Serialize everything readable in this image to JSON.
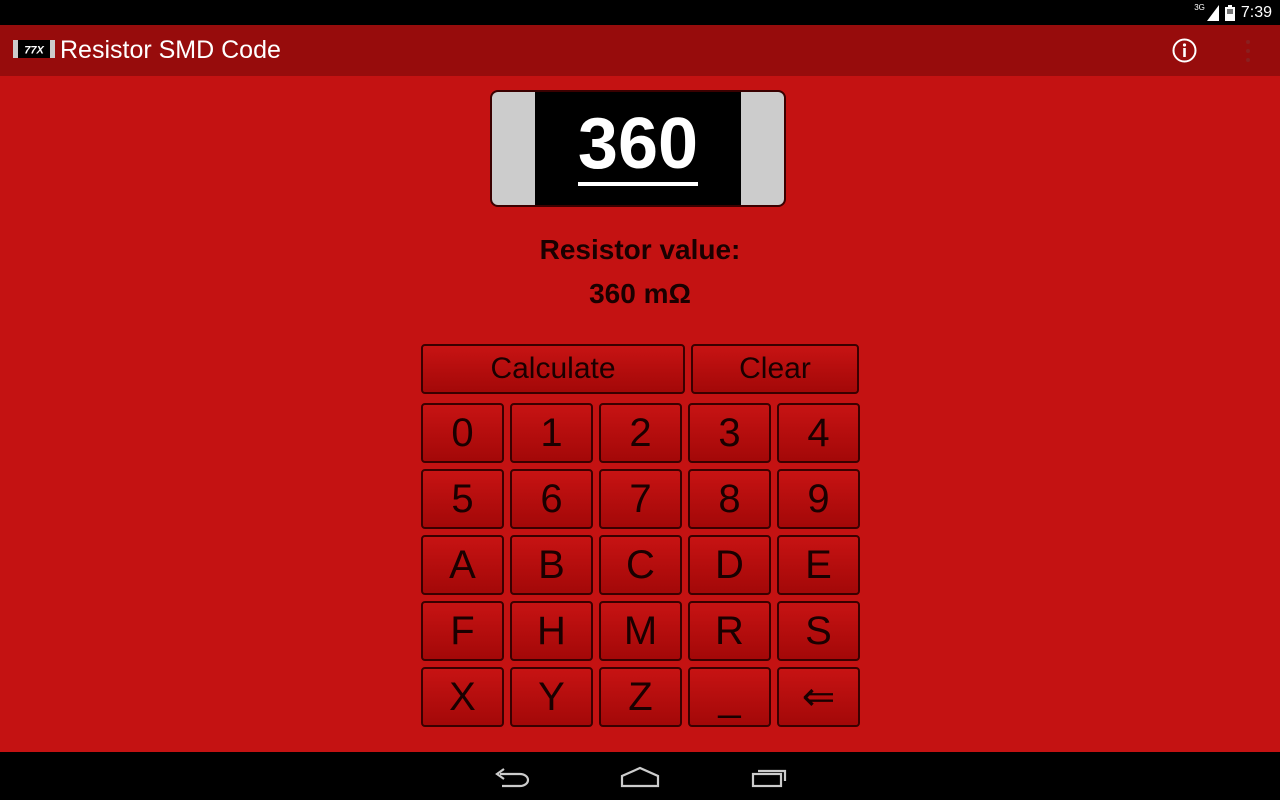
{
  "status": {
    "network": "3G",
    "time": "7:39"
  },
  "app": {
    "title": "Resistor SMD Code",
    "icon_text": "77X"
  },
  "chip": {
    "code": "360"
  },
  "result": {
    "label": "Resistor value:",
    "value": "360 mΩ"
  },
  "buttons": {
    "calculate": "Calculate",
    "clear": "Clear"
  },
  "keypad": [
    [
      "0",
      "1",
      "2",
      "3",
      "4"
    ],
    [
      "5",
      "6",
      "7",
      "8",
      "9"
    ],
    [
      "A",
      "B",
      "C",
      "D",
      "E"
    ],
    [
      "F",
      "H",
      "M",
      "R",
      "S"
    ],
    [
      "X",
      "Y",
      "Z",
      "_",
      "⇐"
    ]
  ],
  "icons": {
    "info": "info-icon",
    "overflow": "overflow-menu-icon",
    "back": "back-icon",
    "home": "home-icon",
    "recents": "recent-apps-icon"
  }
}
